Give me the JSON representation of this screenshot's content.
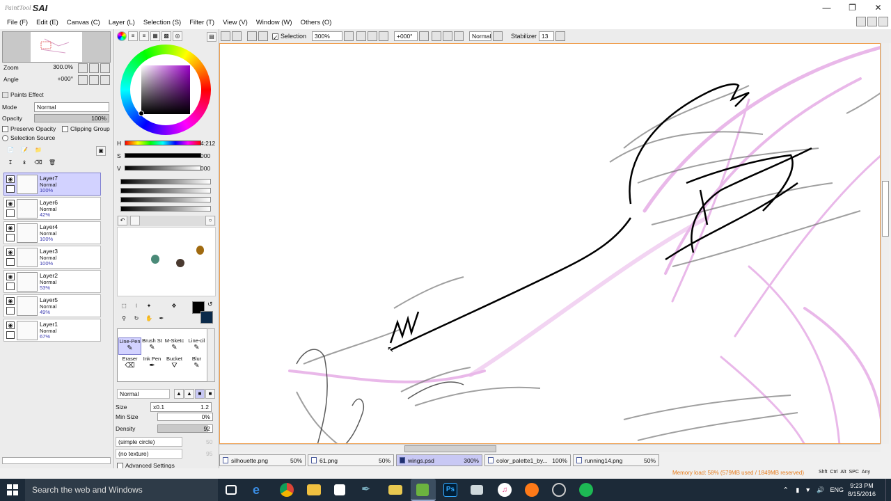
{
  "app": {
    "logo_small": "PaintTool",
    "logo_big": "SAI"
  },
  "menu": [
    "File (F)",
    "Edit (E)",
    "Canvas (C)",
    "Layer (L)",
    "Selection (S)",
    "Filter (T)",
    "View (V)",
    "Window (W)",
    "Others (O)"
  ],
  "navigator": {
    "zoom_label": "Zoom",
    "zoom_value": "300.0%",
    "angle_label": "Angle",
    "angle_value": "+000°"
  },
  "paint_effect": {
    "title": "Paints Effect",
    "mode_label": "Mode",
    "mode_value": "Normal",
    "opacity_label": "Opacity",
    "opacity_value": "100%",
    "preserve_opacity": "Preserve Opacity",
    "clipping_group": "Clipping Group",
    "selection_source": "Selection Source"
  },
  "layers": [
    {
      "name": "Layer7",
      "mode": "Normal",
      "opacity": "100%",
      "selected": true
    },
    {
      "name": "Layer6",
      "mode": "Normal",
      "opacity": "42%",
      "selected": false
    },
    {
      "name": "Layer4",
      "mode": "Normal",
      "opacity": "100%",
      "selected": false
    },
    {
      "name": "Layer3",
      "mode": "Normal",
      "opacity": "100%",
      "selected": false
    },
    {
      "name": "Layer2",
      "mode": "Normal",
      "opacity": "53%",
      "selected": false
    },
    {
      "name": "Layer5",
      "mode": "Normal",
      "opacity": "49%",
      "selected": false
    },
    {
      "name": "Layer1",
      "mode": "Normal",
      "opacity": "67%",
      "selected": false
    }
  ],
  "color": {
    "h_label": "H",
    "h_value": "4:212",
    "s_label": "S",
    "s_value": "000",
    "v_label": "V",
    "v_value": "000",
    "fg": "#000000",
    "bg": "#0b2a4a",
    "swatches": [
      "#4a8a78",
      "#4a3a30",
      "#a06a10"
    ]
  },
  "tools": [
    {
      "label": "Line-Pen",
      "selected": true
    },
    {
      "label": "Brush St",
      "selected": false
    },
    {
      "label": "M-Sketc",
      "selected": false
    },
    {
      "label": "Line-cil",
      "selected": false
    },
    {
      "label": "Eraser",
      "selected": false
    },
    {
      "label": "Ink Pen",
      "selected": false
    },
    {
      "label": "Bucket",
      "selected": false
    },
    {
      "label": "Blur",
      "selected": false
    }
  ],
  "brush": {
    "blend": "Normal",
    "size_label": "Size",
    "size_mult": "x0.1",
    "size_value": "1.2",
    "min_size_label": "Min Size",
    "min_size_value": "0%",
    "density_label": "Density",
    "density_value": "92",
    "shape": "(simple circle)",
    "shape_value": "50",
    "texture": "(no texture)",
    "texture_value": "95",
    "advanced": "Advanced Settings"
  },
  "options_bar": {
    "selection_label": "Selection",
    "zoom": "300%",
    "angle": "+000°",
    "blend": "Normal",
    "stabilizer_label": "Stabilizer",
    "stabilizer_value": "13"
  },
  "tabs": [
    {
      "name": "silhouette.png",
      "zoom": "50%",
      "active": false
    },
    {
      "name": "61.png",
      "zoom": "50%",
      "active": false
    },
    {
      "name": "wings.psd",
      "zoom": "300%",
      "active": true
    },
    {
      "name": "color_palette1_by...",
      "zoom": "100%",
      "active": false
    },
    {
      "name": "running14.png",
      "zoom": "50%",
      "active": false
    }
  ],
  "status": {
    "memory": "Memory load: 58% (579MB used / 1849MB reserved)",
    "keys": [
      "Shft",
      "Ctrl",
      "Alt",
      "SPC",
      "Any"
    ]
  },
  "taskbar": {
    "search_placeholder": "Search the web and Windows",
    "lang": "ENG",
    "time": "9:23 PM",
    "date": "8/15/2016"
  }
}
